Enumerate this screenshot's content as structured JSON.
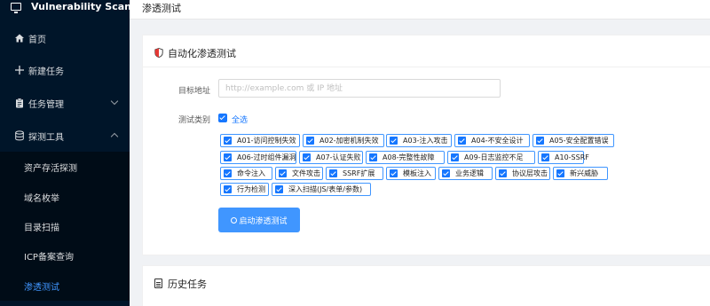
{
  "app": {
    "title": "Vulnerability Scanner"
  },
  "sidebar": {
    "items": [
      {
        "label": "首页",
        "icon": "home-icon"
      },
      {
        "label": "新建任务",
        "icon": "plus-icon"
      },
      {
        "label": "任务管理",
        "icon": "clipboard-icon",
        "expanded": false
      },
      {
        "label": "探测工具",
        "icon": "database-icon",
        "expanded": true
      }
    ],
    "sub_items": [
      {
        "label": "资产存活探测",
        "active": false
      },
      {
        "label": "域名枚举",
        "active": false
      },
      {
        "label": "目录扫描",
        "active": false
      },
      {
        "label": "ICP备案查询",
        "active": false
      },
      {
        "label": "渗透测试",
        "active": true
      }
    ]
  },
  "header": {
    "title": "渗透测试"
  },
  "auto_pentest": {
    "title": "自动化渗透测试",
    "target_label": "目标地址",
    "target_placeholder": "http://example.com 或 IP 地址",
    "target_value": "",
    "category_label": "测试类别",
    "select_all_label": "全选",
    "select_all_checked": true,
    "categories": [
      {
        "label": "A01-访问控制失效",
        "checked": true
      },
      {
        "label": "A02-加密机制失效",
        "checked": true
      },
      {
        "label": "A03-注入攻击",
        "checked": true
      },
      {
        "label": "A04-不安全设计",
        "checked": true
      },
      {
        "label": "A05-安全配置错误",
        "checked": true
      },
      {
        "label": "A06-过时组件漏洞",
        "checked": true
      },
      {
        "label": "A07-认证失败",
        "checked": true
      },
      {
        "label": "A08-完整性故障",
        "checked": true
      },
      {
        "label": "A09-日志监控不足",
        "checked": true
      },
      {
        "label": "A10-SSRF",
        "checked": true
      },
      {
        "label": "命令注入",
        "checked": true
      },
      {
        "label": "文件攻击",
        "checked": true
      },
      {
        "label": "SSRF扩展",
        "checked": true
      },
      {
        "label": "模板注入",
        "checked": true
      },
      {
        "label": "业务逻辑",
        "checked": true
      },
      {
        "label": "协议层攻击",
        "checked": true
      },
      {
        "label": "新兴威胁",
        "checked": true
      },
      {
        "label": "行为检测",
        "checked": true
      },
      {
        "label": "深入扫描(JS/表单/参数)",
        "checked": true
      }
    ],
    "start_button": "启动渗透测试"
  },
  "history": {
    "title": "历史任务"
  },
  "colors": {
    "sidebar_bg": "#001529",
    "primary": "#1677ff",
    "active_text": "#4096ff"
  }
}
